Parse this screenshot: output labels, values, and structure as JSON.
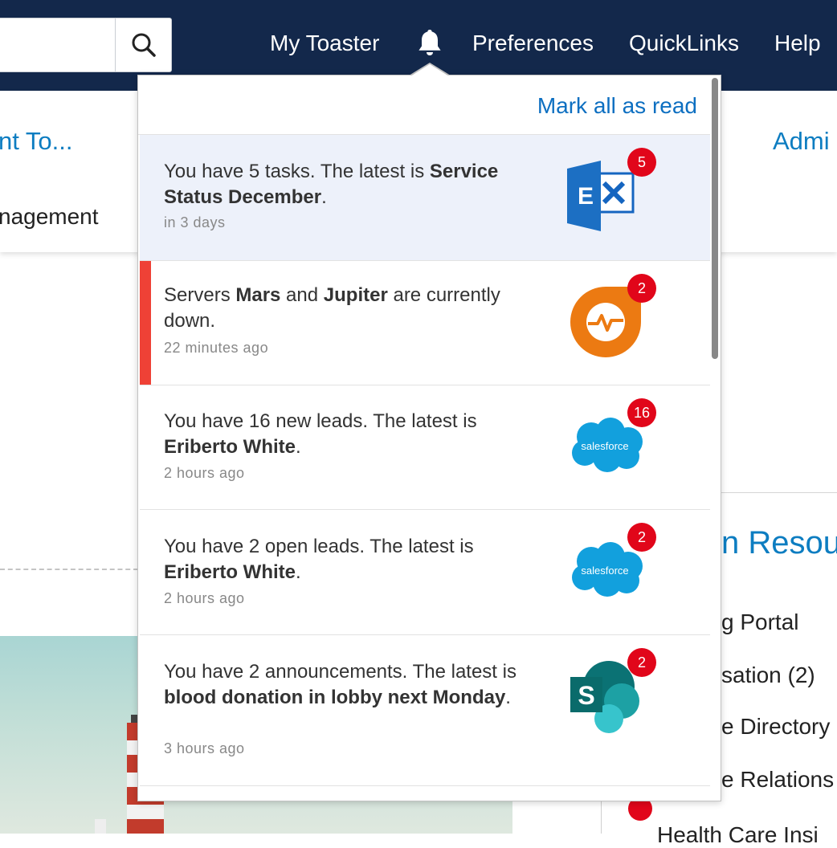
{
  "nav": {
    "search_placeholder": "",
    "items": [
      "My Toaster",
      "Preferences",
      "QuickLinks",
      "Help"
    ]
  },
  "subnav": {
    "link_left": "nt To...",
    "text_left": "nagement",
    "link_right": "Admi"
  },
  "right_panel": {
    "heading": "n Resour",
    "items": [
      "g Portal",
      "sation (2)",
      "e Directory",
      "e Relations"
    ],
    "bottom_text": "Health Care Insi"
  },
  "notifications": {
    "mark_all_label": "Mark all as read",
    "items": [
      {
        "pre": "You have 5 tasks. The latest is ",
        "bold": "Service Status December",
        "post": ".",
        "time": "in 3 days",
        "badge": "5",
        "icon": "exchange-icon",
        "state": "unread"
      },
      {
        "pre": "Servers ",
        "bold": "Mars",
        "mid": " and ",
        "bold2": "Jupiter",
        "post": " are currently down.",
        "time": "22 minutes ago",
        "badge": "2",
        "icon": "monitoring-icon",
        "state": "alert"
      },
      {
        "pre": "You have 16 new leads. The latest is ",
        "bold": "Eriberto White",
        "post": ".",
        "time": "2 hours ago",
        "badge": "16",
        "icon": "salesforce-icon",
        "logo_text": "salesforce"
      },
      {
        "pre": "You have 2 open leads. The latest is ",
        "bold": "Eriberto White",
        "post": ".",
        "time": "2 hours ago",
        "badge": "2",
        "icon": "salesforce-icon",
        "logo_text": "salesforce"
      },
      {
        "pre": "You have 2 announcements. The latest is ",
        "bold": "blood donation in lobby next Monday",
        "post": ".",
        "time": "3 hours ago",
        "badge": "2",
        "icon": "sharepoint-icon"
      }
    ]
  },
  "colors": {
    "topbar": "#13284b",
    "link": "#0d7dc1",
    "badge": "#e1061a",
    "alert": "#ef4136",
    "unread_bg": "#edf1fa"
  }
}
